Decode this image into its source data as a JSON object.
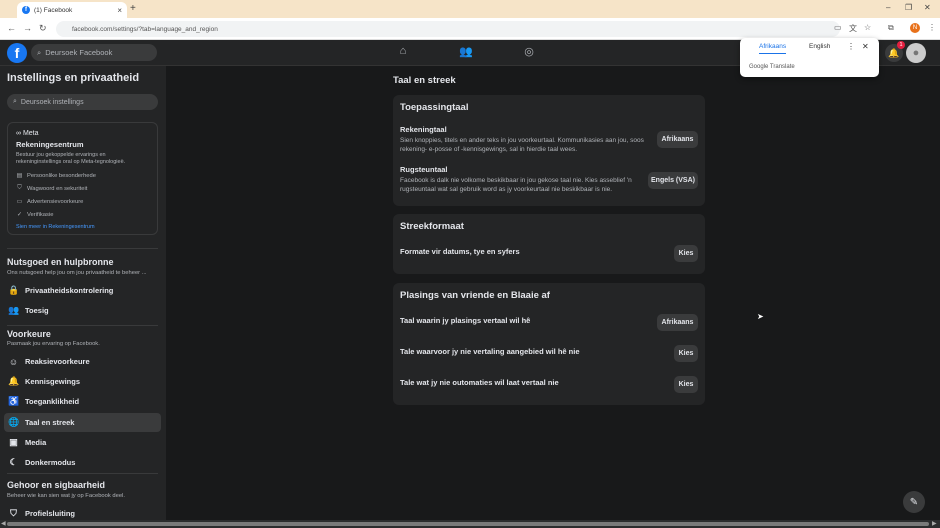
{
  "browser": {
    "tab_title": "(1) Facebook",
    "url": "facebook.com/settings/?tab=language_and_region",
    "profile_initial": "N"
  },
  "fb_nav": {
    "search_placeholder": "Deursoek Facebook",
    "notif_count": "1"
  },
  "sidebar": {
    "title": "Instellings en privaatheid",
    "search_placeholder": "Deursoek instellings",
    "meta": {
      "logo": "Meta",
      "title": "Rekeningesentrum",
      "desc": "Bestuur jou gekoppelde ervarings en rekeninginstellings oral op Meta-tegnologieë.",
      "items": [
        "Persoonlike besonderhede",
        "Wagwoord en sekuriteit",
        "Advertensievoorkeure",
        "Verifikasie"
      ],
      "link": "Sien meer in Rekeningesentrum"
    },
    "sections": [
      {
        "heading": "Nutsgoed en hulpbronne",
        "sub": "Ons nutsgoed help jou om jou privaatheid te beheer ..."
      },
      {
        "heading": "Voorkeure",
        "sub": "Pasmaak jou ervaring op Facebook."
      },
      {
        "heading": "Gehoor en sigbaarheid",
        "sub": "Beheer wie kan sien wat jy op Facebook deel."
      }
    ],
    "items": [
      {
        "label": "Privaatheidskontrolering"
      },
      {
        "label": "Toesig"
      },
      {
        "label": "Reaksievoorkeure"
      },
      {
        "label": "Kennisgewings"
      },
      {
        "label": "Toeganklikheid"
      },
      {
        "label": "Taal en streek"
      },
      {
        "label": "Media"
      },
      {
        "label": "Donkermodus"
      },
      {
        "label": "Profielsluiting"
      }
    ]
  },
  "main": {
    "title": "Taal en streek",
    "cards": [
      {
        "title": "Toepassingtaal",
        "rows": [
          {
            "label": "Rekeningtaal",
            "desc": "Sien knoppies, titels en ander teks in jou voorkeurtaal. Kommunikasies aan jou, soos rekening- e-posse of -kennisgewings, sal in hierdie taal wees.",
            "button": "Afrikaans"
          },
          {
            "label": "Rugsteuntaal",
            "desc": "Facebook is dalk nie volkome beskikbaar in jou gekose taal nie. Kies asseblief 'n rugsteuntaal wat sal gebruik word as jy voorkeurtaal nie beskikbaar is nie.",
            "button": "Engels (VSA)"
          }
        ]
      },
      {
        "title": "Streekformaat",
        "rows": [
          {
            "label": "Formate vir datums, tye en syfers",
            "button": "Kies"
          }
        ]
      },
      {
        "title": "Plasings van vriende en Blaaie af",
        "rows": [
          {
            "label": "Taal waarin jy plasings vertaal wil hê",
            "button": "Afrikaans"
          },
          {
            "label": "Tale waarvoor jy nie vertaling aangebied wil hê nie",
            "button": "Kies"
          },
          {
            "label": "Tale wat jy nie outomaties wil laat vertaal nie",
            "button": "Kies"
          }
        ]
      }
    ]
  },
  "translate_popup": {
    "tab_source": "Afrikaans",
    "tab_target": "English",
    "brand_google": "Google",
    "brand_translate": "Translate"
  },
  "colors": {
    "fb_blue": "#1877f2",
    "bg": "#18191a",
    "surface": "#242526",
    "badge_red": "#e41e3f"
  }
}
